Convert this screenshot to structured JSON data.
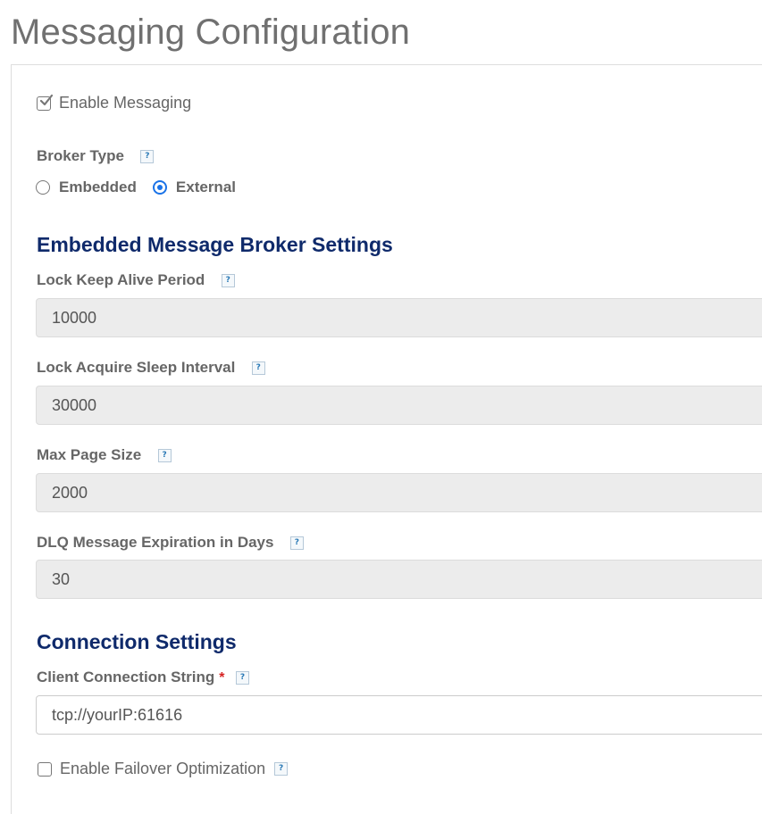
{
  "page": {
    "title": "Messaging Configuration"
  },
  "enable_messaging": {
    "label": "Enable Messaging",
    "checked": true
  },
  "broker_type": {
    "label": "Broker Type",
    "options": [
      "Embedded",
      "External"
    ],
    "selected": "External"
  },
  "embedded_section": {
    "heading": "Embedded Message Broker Settings",
    "fields": [
      {
        "label": "Lock Keep Alive Period",
        "value": "10000"
      },
      {
        "label": "Lock Acquire Sleep Interval",
        "value": "30000"
      },
      {
        "label": "Max Page Size",
        "value": "2000"
      },
      {
        "label": "DLQ Message Expiration in Days",
        "value": "30"
      }
    ]
  },
  "connection_section": {
    "heading": "Connection Settings",
    "client_connection": {
      "label": "Client Connection String",
      "required_marker": "*",
      "value": "tcp://yourIP:61616"
    },
    "failover": {
      "label": "Enable Failover Optimization",
      "checked": false
    }
  },
  "help_icon_text": "?",
  "colors": {
    "heading": "#0f2a6b",
    "accent": "#1a73e8",
    "required": "#d62222",
    "disabled_input_bg": "#ececec"
  }
}
